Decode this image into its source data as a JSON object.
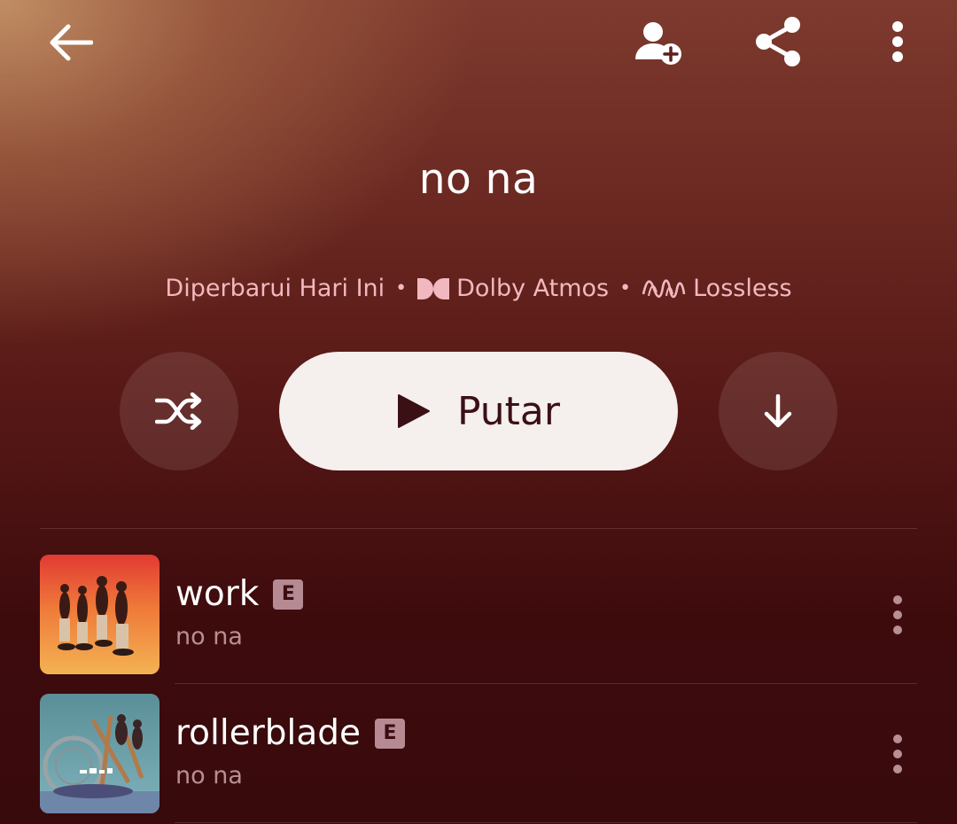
{
  "header": {
    "back_icon": "arrow-left-icon",
    "add_person_icon": "person-add-icon",
    "share_icon": "share-icon",
    "more_icon": "more-vertical-icon"
  },
  "playlist": {
    "title": "no na",
    "updated": "Diperbarui Hari Ini",
    "separator": "•",
    "dolby_label": "Dolby Atmos",
    "lossless_label": "Lossless"
  },
  "controls": {
    "play_label": "Putar",
    "shuffle_icon": "shuffle-icon",
    "download_icon": "download-icon",
    "play_icon": "play-icon"
  },
  "tracks": [
    {
      "title": "work",
      "explicit": "E",
      "artist": "no na"
    },
    {
      "title": "rollerblade",
      "explicit": "E",
      "artist": "no na"
    }
  ],
  "colors": {
    "meta_text": "#f2b8bf",
    "play_button_bg": "#f5efee",
    "play_button_text": "#3b1015",
    "explicit_badge": "#b68a93",
    "artist_text": "#b78f94"
  }
}
